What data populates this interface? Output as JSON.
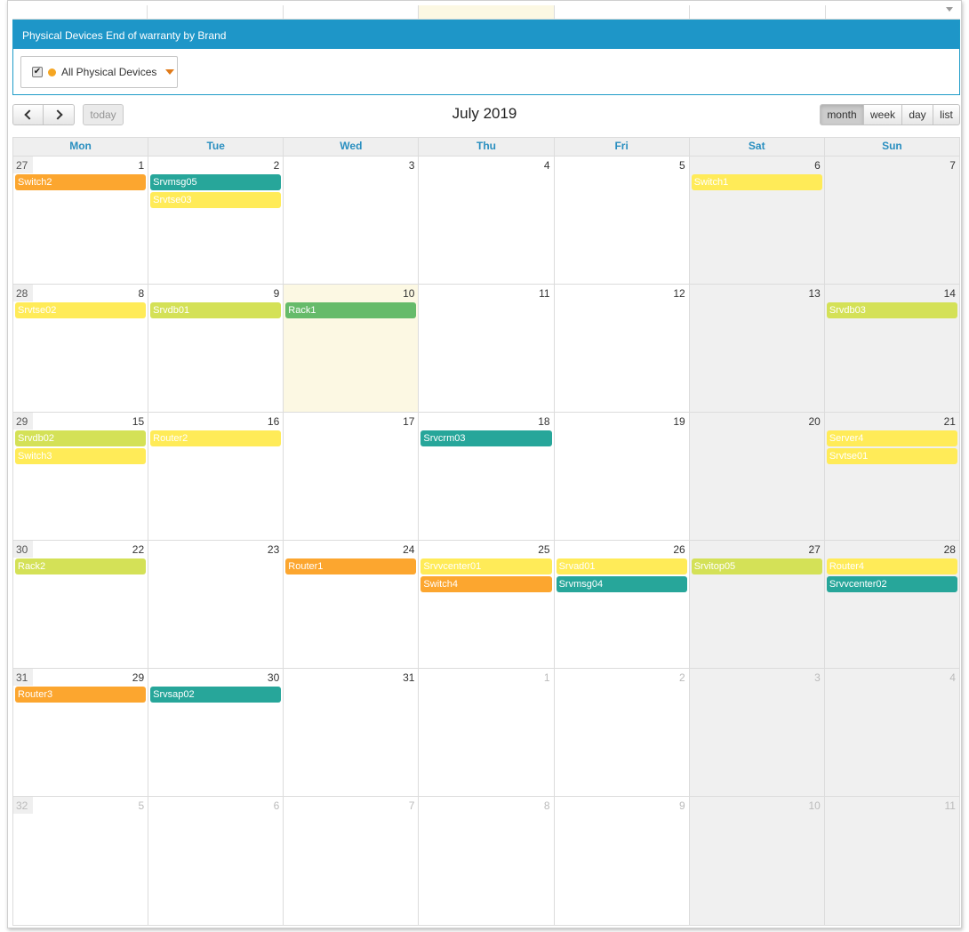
{
  "panel": {
    "header": "Physical Devices End of warranty by Brand",
    "filter_label": "All Physical Devices",
    "filter_checked": true,
    "dot_color": "#f5a623"
  },
  "toolbar": {
    "today_label": "today",
    "title": "July 2019",
    "views": [
      "month",
      "week",
      "day",
      "list"
    ],
    "active_view": "month"
  },
  "colors": {
    "orange": "#fca62f",
    "teal": "#27a69a",
    "yellow": "#ffeb58",
    "lime": "#d4e157",
    "green": "#66bb6a",
    "header": "#1e96c8",
    "today": "#fcf8e3",
    "weekend": "#f0f0f0"
  },
  "calendar": {
    "days_of_week": [
      "Mon",
      "Tue",
      "Wed",
      "Thu",
      "Fri",
      "Sat",
      "Sun"
    ],
    "weeks": [
      {
        "week_num": "27",
        "week_other": false,
        "days": [
          {
            "num": "1",
            "other": false,
            "events": [
              {
                "title": "Switch2",
                "color": "orange"
              }
            ]
          },
          {
            "num": "2",
            "other": false,
            "events": [
              {
                "title": "Srvmsg05",
                "color": "teal"
              },
              {
                "title": "Srvtse03",
                "color": "yellow"
              }
            ]
          },
          {
            "num": "3",
            "other": false,
            "events": []
          },
          {
            "num": "4",
            "other": false,
            "events": []
          },
          {
            "num": "5",
            "other": false,
            "events": []
          },
          {
            "num": "6",
            "other": false,
            "events": [
              {
                "title": "Switch1",
                "color": "yellow"
              }
            ]
          },
          {
            "num": "7",
            "other": false,
            "events": []
          }
        ]
      },
      {
        "week_num": "28",
        "week_other": false,
        "days": [
          {
            "num": "8",
            "other": false,
            "events": [
              {
                "title": "Srvtse02",
                "color": "yellow"
              }
            ]
          },
          {
            "num": "9",
            "other": false,
            "events": [
              {
                "title": "Srvdb01",
                "color": "lime"
              }
            ]
          },
          {
            "num": "10",
            "other": false,
            "today": true,
            "events": [
              {
                "title": "Rack1",
                "color": "green"
              }
            ]
          },
          {
            "num": "11",
            "other": false,
            "events": []
          },
          {
            "num": "12",
            "other": false,
            "events": []
          },
          {
            "num": "13",
            "other": false,
            "events": []
          },
          {
            "num": "14",
            "other": false,
            "events": [
              {
                "title": "Srvdb03",
                "color": "lime"
              }
            ]
          }
        ]
      },
      {
        "week_num": "29",
        "week_other": false,
        "days": [
          {
            "num": "15",
            "other": false,
            "events": [
              {
                "title": "Srvdb02",
                "color": "lime"
              },
              {
                "title": "Switch3",
                "color": "yellow"
              }
            ]
          },
          {
            "num": "16",
            "other": false,
            "events": [
              {
                "title": "Router2",
                "color": "yellow"
              }
            ]
          },
          {
            "num": "17",
            "other": false,
            "events": []
          },
          {
            "num": "18",
            "other": false,
            "events": [
              {
                "title": "Srvcrm03",
                "color": "teal"
              }
            ]
          },
          {
            "num": "19",
            "other": false,
            "events": []
          },
          {
            "num": "20",
            "other": false,
            "events": []
          },
          {
            "num": "21",
            "other": false,
            "events": [
              {
                "title": "Server4",
                "color": "yellow"
              },
              {
                "title": "Srvtse01",
                "color": "yellow"
              }
            ]
          }
        ]
      },
      {
        "week_num": "30",
        "week_other": false,
        "days": [
          {
            "num": "22",
            "other": false,
            "events": [
              {
                "title": "Rack2",
                "color": "lime"
              }
            ]
          },
          {
            "num": "23",
            "other": false,
            "events": []
          },
          {
            "num": "24",
            "other": false,
            "events": [
              {
                "title": "Router1",
                "color": "orange"
              }
            ]
          },
          {
            "num": "25",
            "other": false,
            "events": [
              {
                "title": "Srvvcenter01",
                "color": "yellow"
              },
              {
                "title": "Switch4",
                "color": "orange"
              }
            ]
          },
          {
            "num": "26",
            "other": false,
            "events": [
              {
                "title": "Srvad01",
                "color": "yellow"
              },
              {
                "title": "Srvmsg04",
                "color": "teal"
              }
            ]
          },
          {
            "num": "27",
            "other": false,
            "events": [
              {
                "title": "Srvitop05",
                "color": "lime"
              }
            ]
          },
          {
            "num": "28",
            "other": false,
            "events": [
              {
                "title": "Router4",
                "color": "yellow"
              },
              {
                "title": "Srvvcenter02",
                "color": "teal"
              }
            ]
          }
        ]
      },
      {
        "week_num": "31",
        "week_other": false,
        "days": [
          {
            "num": "29",
            "other": false,
            "events": [
              {
                "title": "Router3",
                "color": "orange"
              }
            ]
          },
          {
            "num": "30",
            "other": false,
            "events": [
              {
                "title": "Srvsap02",
                "color": "teal"
              }
            ]
          },
          {
            "num": "31",
            "other": false,
            "events": []
          },
          {
            "num": "1",
            "other": true,
            "events": []
          },
          {
            "num": "2",
            "other": true,
            "events": []
          },
          {
            "num": "3",
            "other": true,
            "events": []
          },
          {
            "num": "4",
            "other": true,
            "events": []
          }
        ]
      },
      {
        "week_num": "32",
        "week_other": true,
        "days": [
          {
            "num": "5",
            "other": true,
            "events": []
          },
          {
            "num": "6",
            "other": true,
            "events": []
          },
          {
            "num": "7",
            "other": true,
            "events": []
          },
          {
            "num": "8",
            "other": true,
            "events": []
          },
          {
            "num": "9",
            "other": true,
            "events": []
          },
          {
            "num": "10",
            "other": true,
            "events": []
          },
          {
            "num": "11",
            "other": true,
            "events": []
          }
        ]
      }
    ]
  }
}
